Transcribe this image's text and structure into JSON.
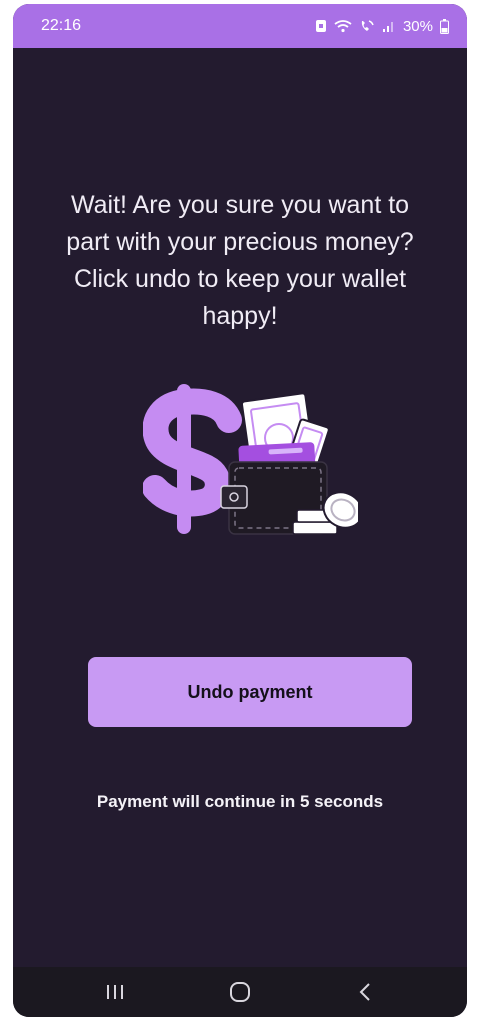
{
  "status_bar": {
    "time": "22:16",
    "battery": "30%",
    "icons": [
      "notification-icon",
      "wifi-icon",
      "wifi-calling-icon",
      "signal-icon",
      "battery-icon"
    ]
  },
  "main": {
    "message": "Wait! Are you sure you want to part with your precious money? Click undo to keep your wallet happy!",
    "illustration": "money-wallet-illustration",
    "undo_button_label": "Undo payment",
    "countdown_text": "Payment will continue in 5 seconds"
  },
  "nav_bar": {
    "buttons": [
      "recent-apps-icon",
      "home-icon",
      "back-icon"
    ]
  },
  "colors": {
    "accent": "#a970e6",
    "button": "#c89af3",
    "background": "#231b2f",
    "nav_background": "#1b1820"
  }
}
